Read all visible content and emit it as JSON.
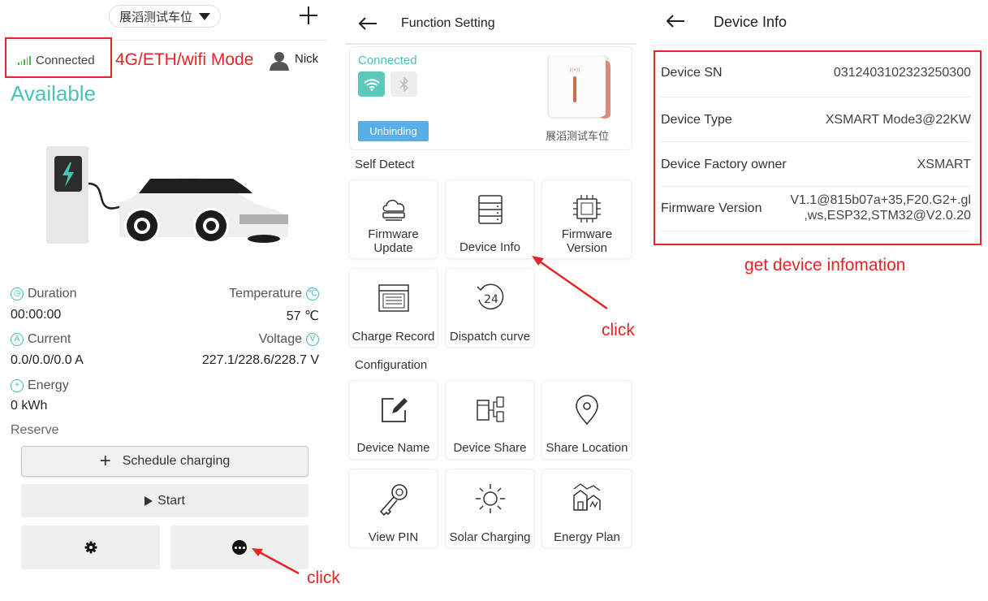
{
  "panel1": {
    "station_name": "展滔测试车位",
    "connection": "Connected",
    "mode_annotation": "4G/ETH/wifi Mode",
    "user_name": "Nick",
    "status": "Available",
    "duration_label": "Duration",
    "duration_value": "00:00:00",
    "temperature_label": "Temperature",
    "temperature_value": "57 ℃",
    "current_label": "Current",
    "current_value": "0.0/0.0/0.0 A",
    "voltage_label": "Voltage",
    "voltage_value": "227.1/228.6/228.7 V",
    "energy_label": "Energy",
    "energy_value": "0 kWh",
    "reserve_label": "Reserve",
    "schedule_label": "Schedule charging",
    "start_label": "Start",
    "click_annotation": "click",
    "accent_color": "#48c3b6",
    "annotation_color": "#e52525"
  },
  "panel2": {
    "title": "Function Setting",
    "card_connection": "Connected",
    "unbinding_label": "Unbinding",
    "station_name": "展滔测试车位",
    "self_detect_label": "Self Detect",
    "configuration_label": "Configuration",
    "tiles_self_detect": [
      {
        "label1": "Firmware",
        "label2": "Update",
        "icon": "cloud-upload-icon"
      },
      {
        "label1": "Device Info",
        "label2": "",
        "icon": "server-icon"
      },
      {
        "label1": "Firmware",
        "label2": "Version",
        "icon": "chip-icon"
      },
      {
        "label1": "Charge Record",
        "label2": "",
        "icon": "record-list-icon"
      },
      {
        "label1": "Dispatch curve",
        "label2": "",
        "icon": "clock-24-icon"
      }
    ],
    "tiles_configuration": [
      {
        "label1": "Device Name",
        "label2": "",
        "icon": "edit-icon"
      },
      {
        "label1": "Device Share",
        "label2": "",
        "icon": "share-devices-icon"
      },
      {
        "label1": "Share Location",
        "label2": "",
        "icon": "location-pin-icon"
      },
      {
        "label1": "View PIN",
        "label2": "",
        "icon": "key-icon"
      },
      {
        "label1": "Solar Charging",
        "label2": "",
        "icon": "sun-icon"
      },
      {
        "label1": "Energy Plan",
        "label2": "",
        "icon": "energy-plan-icon"
      }
    ],
    "click_annotation": "click"
  },
  "panel3": {
    "title": "Device Info",
    "rows": [
      {
        "key": "Device SN",
        "value": "0312403102323250300"
      },
      {
        "key": "Device Type",
        "value": "XSMART Mode3@22KW"
      },
      {
        "key": "Device Factory owner",
        "value": "XSMART"
      },
      {
        "key": "Firmware Version",
        "value_line1": "V1.1@815b07a+35,F20.G2+.gl",
        "value_line2": ",ws,ESP32,STM32@V2.0.20"
      }
    ],
    "annotation": "get device infomation"
  }
}
